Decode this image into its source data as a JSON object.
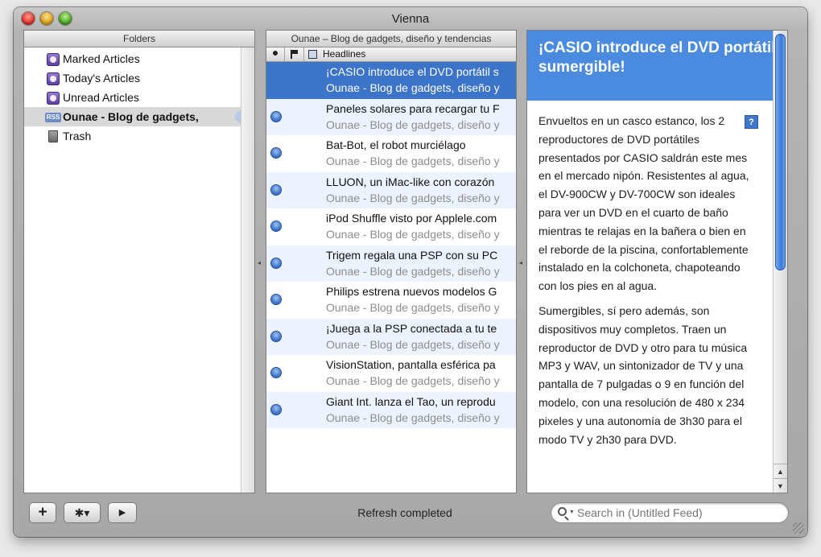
{
  "window": {
    "title": "Vienna"
  },
  "folders": {
    "header": "Folders",
    "items": [
      {
        "label": "Marked Articles",
        "icon": "smart-folder-icon"
      },
      {
        "label": "Today's Articles",
        "icon": "smart-folder-icon"
      },
      {
        "label": "Unread Articles",
        "icon": "smart-folder-icon"
      },
      {
        "label": "Ounae - Blog de gadgets,",
        "icon": "rss-icon",
        "selected": true
      },
      {
        "label": "Trash",
        "icon": "trash-icon"
      }
    ],
    "rss_badge": "RSS"
  },
  "headlines": {
    "header": "Ounae – Blog de gadgets, diseño y tendencias",
    "column_label": "Headlines",
    "rows": [
      {
        "title": "¡CASIO introduce el DVD portátil s",
        "feed": "Ounae - Blog de gadgets, diseño y",
        "selected": true
      },
      {
        "title": "Paneles solares para recargar tu F",
        "feed": "Ounae - Blog de gadgets, diseño y"
      },
      {
        "title": "Bat-Bot, el robot murciélago",
        "feed": "Ounae - Blog de gadgets, diseño y"
      },
      {
        "title": "LLUON, un iMac-like con corazón",
        "feed": "Ounae - Blog de gadgets, diseño y"
      },
      {
        "title": "iPod Shuffle visto por Applele.com",
        "feed": "Ounae - Blog de gadgets, diseño y"
      },
      {
        "title": "Trigem regala una PSP con su PC",
        "feed": "Ounae - Blog de gadgets, diseño y"
      },
      {
        "title": "Philips estrena nuevos modelos G",
        "feed": "Ounae - Blog de gadgets, diseño y"
      },
      {
        "title": "¡Juega a la PSP conectada a tu te",
        "feed": "Ounae - Blog de gadgets, diseño y"
      },
      {
        "title": "VisionStation, pantalla esférica pa",
        "feed": "Ounae - Blog de gadgets, diseño y"
      },
      {
        "title": "Giant Int. lanza el Tao, un reprodu",
        "feed": "Ounae - Blog de gadgets, diseño y"
      }
    ]
  },
  "article": {
    "title": "¡CASIO introduce el DVD portátil sumergible!",
    "help_label": "?",
    "paragraphs": [
      "Envueltos en un casco estanco, los 2 reproductores de DVD portátiles presentados por CASIO saldrán este mes en el mercado nipón. Resistentes al agua, el DV-900CW y DV-700CW son ideales para ver un DVD en el cuarto de baño mientras te relajas en la bañera o bien en el reborde de la piscina, confortablemente instalado en la colchoneta, chapoteando con los pies en al agua.",
      "Sumergibles, sí pero además, son dispositivos muy completos. Traen un reproductor de DVD y otro para tu música MP3 y WAV, un sintonizador de TV y una pantalla de 7 pulgadas o 9 en función del modelo, con una resolución de 480 x 234 pixeles y una autonomía de 3h30 para el modo TV y 2h30 para DVD."
    ]
  },
  "toolbar": {
    "add_label": "+",
    "gear_label": "✱▾",
    "play_label": "▶",
    "status": "Refresh completed",
    "search_placeholder": "Search in (Untitled Feed)"
  },
  "colors": {
    "selection": "#3c74c9",
    "article_header": "#4a8be0"
  }
}
